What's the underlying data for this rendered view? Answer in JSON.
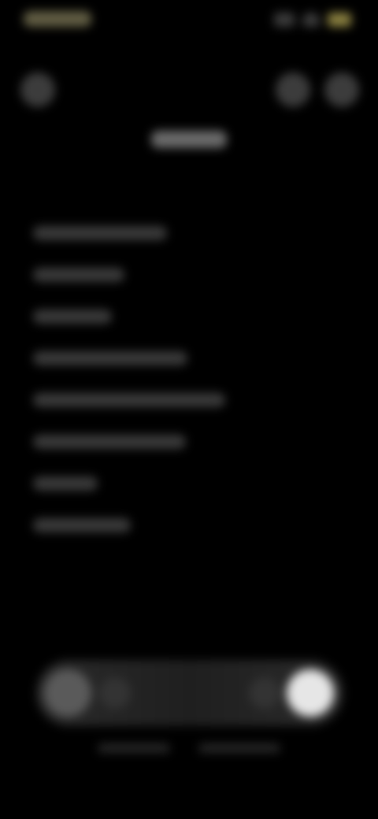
{
  "status_bar": {
    "icons": [
      "signal-icon",
      "wifi-icon",
      "battery-icon"
    ],
    "time_color": "#8a8560",
    "battery_color": "#8a8040"
  },
  "header": {
    "icons": [
      "back-icon",
      "search-icon",
      "more-icon"
    ]
  },
  "menu": {
    "items": [
      {
        "bar": 170
      },
      {
        "bar": 116
      },
      {
        "bar": 100
      },
      {
        "bar": 196
      },
      {
        "bar": 244
      },
      {
        "bar": 194
      },
      {
        "bar": 82
      },
      {
        "bar": 124
      }
    ]
  },
  "dock": {
    "icons": [
      "menu-icon",
      "home-icon",
      "app-icon",
      "profile-icon"
    ],
    "active_color": "#e6e6e6"
  },
  "colors": {
    "background": "#000000",
    "text_dim": "#5a5a5a",
    "accent": "#8a8040"
  }
}
